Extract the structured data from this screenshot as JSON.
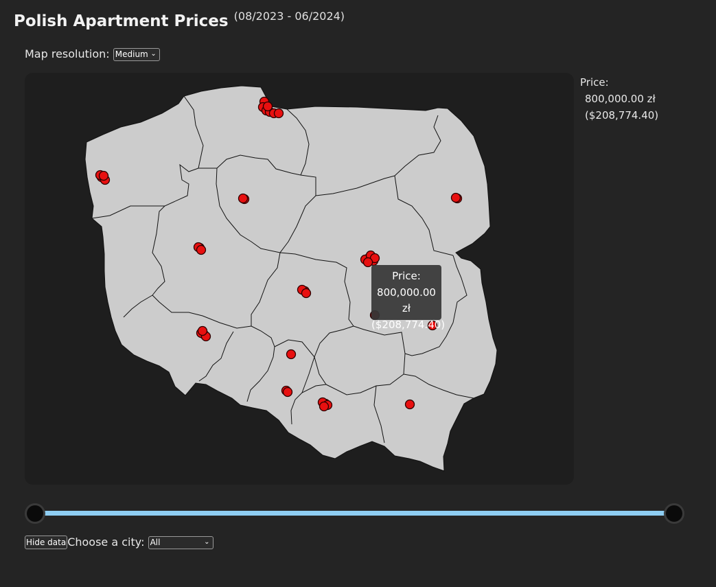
{
  "header": {
    "title": "Polish Apartment Prices",
    "subtitle": "(08/2023 - 06/2024)"
  },
  "controls": {
    "resolution_label": "Map resolution:",
    "resolution_value": "Medium",
    "hide_button": "Hide data",
    "city_label": "Choose a city:",
    "city_value": "All"
  },
  "tooltip": {
    "label": "Price:",
    "pln": "800,000.00 zł",
    "usd": "($208,774.40)"
  },
  "info_panel": {
    "label": "Price:",
    "pln": "800,000.00 zł",
    "usd": "($208,774.40)"
  },
  "map": {
    "land_color": "#cccccc",
    "border_color": "#111111",
    "point_color": "#e81010",
    "highlight_color": "#7a0a0a",
    "slider_color": "#8ecdf2"
  }
}
